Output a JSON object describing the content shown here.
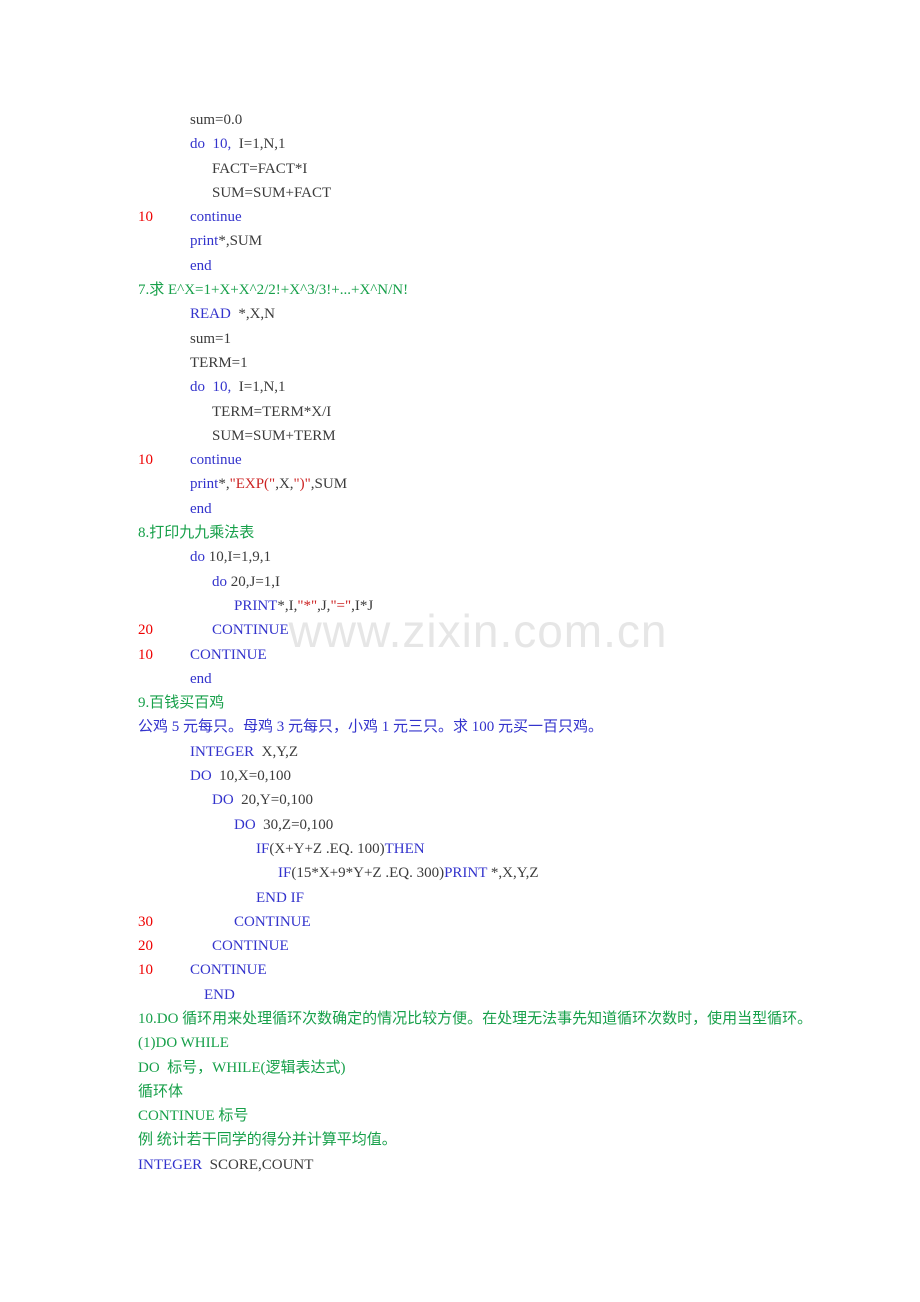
{
  "document": {
    "watermark": "www.zixin.com.cn",
    "colors": {
      "heading_green": "#17a04a",
      "keyword_blue": "#3333cc",
      "label_red": "#ee0000",
      "string_red": "#cc2222",
      "body_gray": "#3b3b3b",
      "watermark_gray": "#e6e6e6",
      "page_background": "#ffffff"
    },
    "lines": [
      {
        "id": "l01",
        "indent": "i2",
        "label": "",
        "tokens": [
          {
            "t": "sum=0.0",
            "c": "id"
          }
        ]
      },
      {
        "id": "l02",
        "indent": "i2",
        "label": "",
        "tokens": [
          {
            "t": "do  10,  ",
            "c": "kw"
          },
          {
            "t": "I=1,N,1",
            "c": "id"
          }
        ]
      },
      {
        "id": "l03",
        "indent": "i3",
        "label": "",
        "tokens": [
          {
            "t": "FACT=FACT*I",
            "c": "id"
          }
        ]
      },
      {
        "id": "l04",
        "indent": "i3",
        "label": "",
        "tokens": [
          {
            "t": "SUM=SUM+FACT",
            "c": "id"
          }
        ]
      },
      {
        "id": "l05",
        "indent": "i2",
        "label": "10",
        "tokens": [
          {
            "t": "continue",
            "c": "kw"
          }
        ]
      },
      {
        "id": "l06",
        "indent": "i2",
        "label": "",
        "tokens": [
          {
            "t": "print",
            "c": "kw"
          },
          {
            "t": "*,SUM",
            "c": "id"
          }
        ]
      },
      {
        "id": "l07",
        "indent": "i2",
        "label": "",
        "tokens": [
          {
            "t": "end",
            "c": "kw"
          }
        ]
      },
      {
        "id": "l08",
        "indent": "i0",
        "label": "",
        "tokens": [
          {
            "t": "7.求 E^X=1+X+X^2/2!+X^3/3!+...+X^N/N!",
            "c": "head"
          }
        ]
      },
      {
        "id": "l09",
        "indent": "i2",
        "label": "",
        "tokens": [
          {
            "t": "READ ",
            "c": "kw"
          },
          {
            "t": " *,X,N",
            "c": "id"
          }
        ]
      },
      {
        "id": "l10",
        "indent": "i2",
        "label": "",
        "tokens": [
          {
            "t": "sum=1",
            "c": "id"
          }
        ]
      },
      {
        "id": "l11",
        "indent": "i2",
        "label": "",
        "tokens": [
          {
            "t": "TERM=1",
            "c": "id"
          }
        ]
      },
      {
        "id": "l12",
        "indent": "i2",
        "label": "",
        "tokens": [
          {
            "t": "do  10,  ",
            "c": "kw"
          },
          {
            "t": "I=1,N,1",
            "c": "id"
          }
        ]
      },
      {
        "id": "l13",
        "indent": "i3",
        "label": "",
        "tokens": [
          {
            "t": "TERM=TERM*X/I",
            "c": "id"
          }
        ]
      },
      {
        "id": "l14",
        "indent": "i3",
        "label": "",
        "tokens": [
          {
            "t": "SUM=SUM+TERM",
            "c": "id"
          }
        ]
      },
      {
        "id": "l15",
        "indent": "i2",
        "label": "10",
        "tokens": [
          {
            "t": "continue",
            "c": "kw"
          }
        ]
      },
      {
        "id": "l16",
        "indent": "i2",
        "label": "",
        "tokens": [
          {
            "t": "print",
            "c": "kw"
          },
          {
            "t": "*,",
            "c": "id"
          },
          {
            "t": "\"EXP(\"",
            "c": "str"
          },
          {
            "t": ",X,",
            "c": "id"
          },
          {
            "t": "\")\"",
            "c": "str"
          },
          {
            "t": ",SUM",
            "c": "id"
          }
        ]
      },
      {
        "id": "l17",
        "indent": "i2",
        "label": "",
        "tokens": [
          {
            "t": "end",
            "c": "kw"
          }
        ]
      },
      {
        "id": "l18",
        "indent": "i0",
        "label": "",
        "tokens": [
          {
            "t": "8.打印九九乘法表",
            "c": "head"
          }
        ]
      },
      {
        "id": "l19",
        "indent": "i2",
        "label": "",
        "tokens": [
          {
            "t": "do ",
            "c": "kw"
          },
          {
            "t": "10,I=1,9,1",
            "c": "id"
          }
        ]
      },
      {
        "id": "l20",
        "indent": "i3",
        "label": "",
        "tokens": [
          {
            "t": "do ",
            "c": "kw"
          },
          {
            "t": "20,J=1,I",
            "c": "id"
          }
        ]
      },
      {
        "id": "l21",
        "indent": "i4",
        "label": "",
        "tokens": [
          {
            "t": "PRINT",
            "c": "kw"
          },
          {
            "t": "*,I,",
            "c": "id"
          },
          {
            "t": "\"*\"",
            "c": "str"
          },
          {
            "t": ",J,",
            "c": "id"
          },
          {
            "t": "\"=\"",
            "c": "str"
          },
          {
            "t": ",I*J",
            "c": "id"
          }
        ]
      },
      {
        "id": "l22",
        "indent": "i3",
        "label": "20",
        "tokens": [
          {
            "t": "CONTINUE",
            "c": "kw"
          }
        ]
      },
      {
        "id": "l23",
        "indent": "i2",
        "label": "10",
        "tokens": [
          {
            "t": "CONTINUE",
            "c": "kw"
          }
        ]
      },
      {
        "id": "l24",
        "indent": "i2",
        "label": "",
        "tokens": [
          {
            "t": "end",
            "c": "kw"
          }
        ]
      },
      {
        "id": "l25",
        "indent": "i0",
        "label": "",
        "tokens": [
          {
            "t": "9.百钱买百鸡",
            "c": "head"
          }
        ]
      },
      {
        "id": "l26",
        "indent": "i0",
        "label": "",
        "tokens": [
          {
            "t": "公鸡 5 元每只。母鸡 3 元每只，小鸡 1 元三只。求 100 元买一百只鸡。",
            "c": "blue-zh"
          }
        ]
      },
      {
        "id": "l27",
        "indent": "i2",
        "label": "",
        "tokens": [
          {
            "t": "INTEGER ",
            "c": "kw"
          },
          {
            "t": " X,Y,Z",
            "c": "id"
          }
        ]
      },
      {
        "id": "l28",
        "indent": "i2",
        "label": "",
        "tokens": [
          {
            "t": "DO ",
            "c": "kw"
          },
          {
            "t": " 10,X=0,100",
            "c": "id"
          }
        ]
      },
      {
        "id": "l29",
        "indent": "i3",
        "label": "",
        "tokens": [
          {
            "t": "DO ",
            "c": "kw"
          },
          {
            "t": " 20,Y=0,100",
            "c": "id"
          }
        ]
      },
      {
        "id": "l30",
        "indent": "i4",
        "label": "",
        "tokens": [
          {
            "t": "DO ",
            "c": "kw"
          },
          {
            "t": " 30,Z=0,100",
            "c": "id"
          }
        ]
      },
      {
        "id": "l31",
        "indent": "i5",
        "label": "",
        "tokens": [
          {
            "t": "IF",
            "c": "kw"
          },
          {
            "t": "(X+Y+Z .EQ. 100)",
            "c": "id"
          },
          {
            "t": "THEN",
            "c": "kw"
          }
        ]
      },
      {
        "id": "l32",
        "indent": "i6",
        "label": "",
        "tokens": [
          {
            "t": "IF",
            "c": "kw"
          },
          {
            "t": "(15*X+9*Y+Z .EQ. 300)",
            "c": "id"
          },
          {
            "t": "PRINT ",
            "c": "kw"
          },
          {
            "t": "*,X,Y,Z",
            "c": "id"
          }
        ]
      },
      {
        "id": "l33",
        "indent": "i5",
        "label": "",
        "tokens": [
          {
            "t": "END IF",
            "c": "kw"
          }
        ]
      },
      {
        "id": "l34",
        "indent": "i4",
        "label": "30",
        "tokens": [
          {
            "t": "CONTINUE",
            "c": "kw"
          }
        ]
      },
      {
        "id": "l35",
        "indent": "i3",
        "label": "20",
        "tokens": [
          {
            "t": "CONTINUE",
            "c": "kw"
          }
        ]
      },
      {
        "id": "l36",
        "indent": "i2",
        "label": "10",
        "tokens": [
          {
            "t": "CONTINUE",
            "c": "kw"
          }
        ]
      },
      {
        "id": "l37",
        "indent": "i7",
        "label": "",
        "tokens": [
          {
            "t": "END",
            "c": "kw"
          }
        ]
      },
      {
        "id": "l38",
        "indent": "i0",
        "label": "",
        "tokens": [
          {
            "t": "10.DO 循环用来处理循环次数确定的情况比较方便。在处理无法事先知道循环次数时，使用当型循环。",
            "c": "head"
          }
        ]
      },
      {
        "id": "l39",
        "indent": "i0",
        "label": "",
        "tokens": [
          {
            "t": "(1)DO WHILE",
            "c": "head"
          }
        ]
      },
      {
        "id": "l40",
        "indent": "i0",
        "label": "",
        "tokens": [
          {
            "t": "DO  标号，WHILE(逻辑表达式)",
            "c": "head"
          }
        ]
      },
      {
        "id": "l41",
        "indent": "i0",
        "label": "",
        "tokens": [
          {
            "t": "循环体",
            "c": "head"
          }
        ]
      },
      {
        "id": "l42",
        "indent": "i0",
        "label": "",
        "tokens": [
          {
            "t": "CONTINUE 标号",
            "c": "head"
          }
        ]
      },
      {
        "id": "l43",
        "indent": "i0",
        "label": "",
        "tokens": [
          {
            "t": "例 统计若干同学的得分并计算平均值。",
            "c": "head"
          }
        ]
      },
      {
        "id": "l44",
        "indent": "i0",
        "label": "",
        "tokens": [
          {
            "t": "INTEGER ",
            "c": "kw"
          },
          {
            "t": " SCORE,COUNT",
            "c": "id"
          }
        ]
      }
    ]
  }
}
